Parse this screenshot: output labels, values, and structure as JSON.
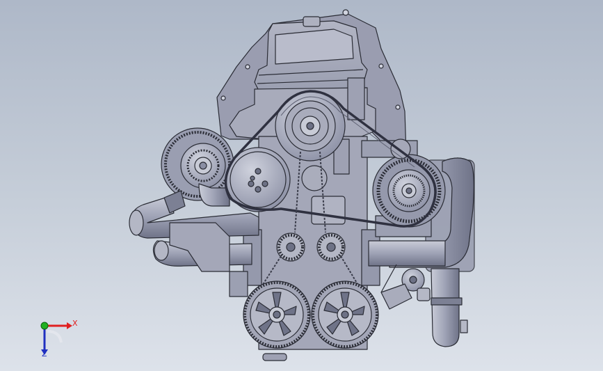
{
  "viewport": {
    "background_top": "#aeb8c8",
    "background_bottom": "#dde2ea"
  },
  "model": {
    "body_color": "#a3a6b8",
    "edge_color": "#2a2c35",
    "shade_color": "#8a8ea3",
    "light_color": "#c4c7d4"
  },
  "triad": {
    "x_label": "X",
    "z_label": "Z",
    "x_color": "#e02020",
    "y_color": "#20b020",
    "z_color": "#2030c0"
  }
}
